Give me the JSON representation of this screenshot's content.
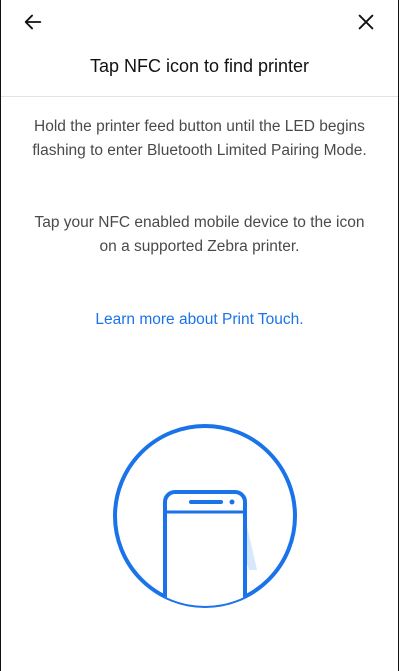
{
  "header": {
    "back_icon": "arrow-left-icon",
    "close_icon": "close-icon"
  },
  "content": {
    "title": "Tap NFC icon to find printer",
    "paragraph1": "Hold the printer feed button until the LED begins flashing to enter Bluetooth Limited Pairing Mode.",
    "paragraph2": "Tap your NFC enabled mobile device to the icon on a supported Zebra printer.",
    "link": "Learn more about Print Touch."
  },
  "illustration": {
    "icon": "phone-nfc-icon",
    "accent": "#1a73e8"
  }
}
